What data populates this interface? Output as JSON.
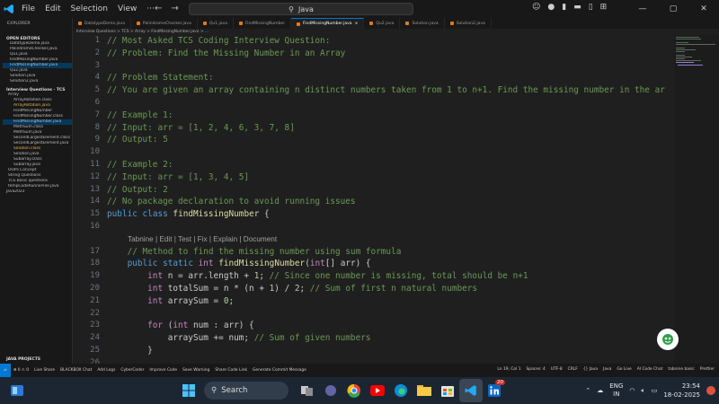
{
  "menu": [
    "File",
    "Edit",
    "Selection",
    "View",
    "···"
  ],
  "command_center": {
    "text": "Java"
  },
  "window_controls": [
    "—",
    "▢",
    "✕"
  ],
  "sidebar": {
    "header": "EXPLORER",
    "open_editors_title": "OPEN EDITORS",
    "open_editors": [
      "DatatypeDemo.java",
      "PalindromeChecker.java",
      "Qu1.java",
      "FindMissingNumber.java",
      "FindMissingNumber.java",
      "Qu2.java",
      "Solution.java",
      "Solution2.java"
    ],
    "project_title": "Interview Questions · TCS",
    "tree": [
      "Array",
      "ArrayRotation.class",
      "ArrayRotation.java",
      "FindMissingNumber",
      "FindMissingNumber.class",
      "FindMissingNumber.java",
      "MethSum.class",
      "MethSum.java",
      "SecondLargestElement.class",
      "SecondLargestElement.java",
      "Solution.class",
      "Solution.java",
      "Subarray.class",
      "Subarray.java",
      "OOPs Concept",
      "String Questions",
      "TCS Basic questions",
      "tempCodeRunnerFile.java",
      "Java2023"
    ],
    "bottom_section": "JAVA PROJECTS"
  },
  "tabs": [
    "DatatypeDemo.java",
    "PalindromeChecker.java",
    "Qu1.java",
    "FindMissingNumber",
    "FindMissingNumber.java",
    "Qu2.java",
    "Solution.java",
    "Solution2.java"
  ],
  "breadcrumb": "Interview Questions > TCS > Array > FindMissingNumber.java > ...",
  "editor": {
    "lines": [
      {
        "n": "1",
        "text": "// Most Asked TCS Coding Interview Question:"
      },
      {
        "n": "2",
        "text": "// Problem: Find the Missing Number in an Array"
      },
      {
        "n": "3",
        "text": ""
      },
      {
        "n": "4",
        "text": "// Problem Statement:"
      },
      {
        "n": "5",
        "text": "// You are given an array containing n distinct numbers taken from 1 to n+1. Find the missing number in the arra"
      },
      {
        "n": "6",
        "text": ""
      },
      {
        "n": "7",
        "text": "// Example 1:"
      },
      {
        "n": "8",
        "text": "// Input: arr = [1, 2, 4, 6, 3, 7, 8]"
      },
      {
        "n": "9",
        "text": "// Output: 5"
      },
      {
        "n": "10",
        "text": ""
      },
      {
        "n": "11",
        "text": "// Example 2:"
      },
      {
        "n": "12",
        "text": "// Input: arr = [1, 3, 4, 5]"
      },
      {
        "n": "13",
        "text": "// Output: 2"
      },
      {
        "n": "14",
        "text": "// No package declaration to avoid running issues"
      },
      {
        "n": "15",
        "text": "public class findMissingNumber {"
      },
      {
        "n": "16",
        "text": ""
      },
      {
        "n": "",
        "text": "Tabnine | Edit | Test | Fix | Explain | Document"
      },
      {
        "n": "17",
        "text": "    // Method to find the missing number using sum formula"
      },
      {
        "n": "18",
        "text": "    public static int findMissingNumber(int[] arr) {"
      },
      {
        "n": "19",
        "text": "        int n = arr.length + 1; // Since one number is missing, total should be n+1"
      },
      {
        "n": "20",
        "text": "        int totalSum = n * (n + 1) / 2; // Sum of first n natural numbers"
      },
      {
        "n": "21",
        "text": "        int arraySum = 0;"
      },
      {
        "n": "22",
        "text": ""
      },
      {
        "n": "23",
        "text": "        for (int num : arr) {"
      },
      {
        "n": "24",
        "text": "            arraySum += num; // Sum of given numbers"
      },
      {
        "n": "25",
        "text": "        }"
      },
      {
        "n": "26",
        "text": ""
      }
    ]
  },
  "statusbar": {
    "left": [
      "⊗ 0 ⚠ 0",
      "Live Share",
      "BLACKBOX Chat",
      "Add Logs",
      "CyberCoder",
      "Improve Code",
      "Save Warning",
      "Share Code Link",
      "Generate Commit Message"
    ],
    "right": [
      "Ln 19, Col 1",
      "Spaces: 4",
      "UTF-8",
      "CRLF",
      "{} Java",
      "Java",
      "Go Live",
      "AI Code Chat",
      "tabnine basic",
      "Prettier"
    ]
  },
  "taskbar": {
    "search_label": "Search",
    "badge": "20",
    "lang_top": "ENG",
    "lang_bottom": "IN",
    "time": "23:54",
    "date": "18-02-2025"
  }
}
